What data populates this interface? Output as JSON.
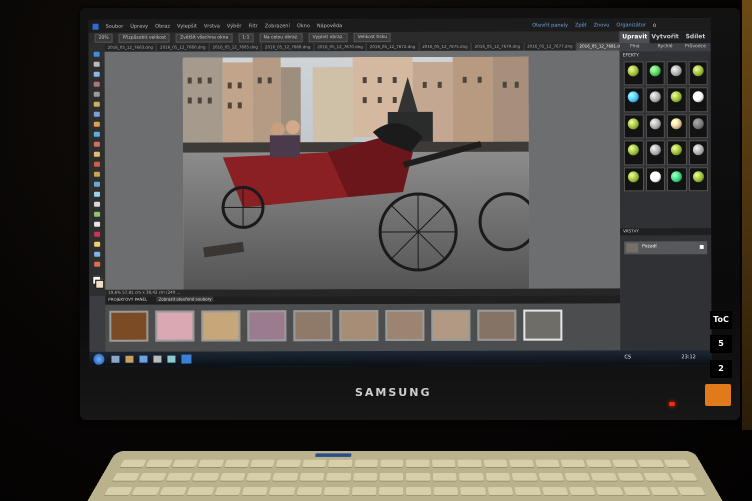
{
  "monitor": {
    "brand": "SAMSUNG"
  },
  "stickers": {
    "top": "ToC",
    "mid": "5",
    "bottom": "2"
  },
  "app": {
    "menu": [
      "Soubor",
      "Úpravy",
      "Obraz",
      "Vylepšit",
      "Vrstva",
      "Výběr",
      "Filtr",
      "Zobrazení",
      "Okno",
      "Nápověda"
    ],
    "top_right": {
      "open_panel": "Otevřít panely",
      "undo": "Zpět",
      "redo": "Znovu",
      "organizer": "Organizátor"
    },
    "options": {
      "zoom": "20%",
      "fit": "Přizpůsobit velikost",
      "fill": "Zvětšit všechna okna",
      "one_to_one": "1:1",
      "fit_screen": "Na celou obraz.",
      "fill_screen": "Vyplnit obraz.",
      "print_size": "Velikost tisku"
    },
    "tabs": [
      "2016_05_12_7663.dng",
      "2016_05_12_7660.dng",
      "2016_05_12_7665.dng",
      "2016_05_12_7668.dng",
      "2016_05_12_7670.dng",
      "2016_05_12_7672.dng",
      "2016_05_12_7675.dng",
      "2016_05_12_7679.dng",
      "2016_05_12_7677.dng",
      "2016_05_12_7681.dng @ 19,6% (RGB/8)"
    ],
    "status_text": "19,6%  57,81 cm x 38,42 cm (240 …",
    "bin_title": "PROJEKTOVÝ PANEL",
    "bin_dropdown": "Zobrazit otevřené soubory",
    "panel": {
      "tabs": [
        "Upravit",
        "Vytvořit",
        "Sdílet"
      ],
      "subtabs": [
        "Plná",
        "Rychlé",
        "Průvodce"
      ],
      "section_effects": "EFEKTY",
      "section_layers": "VRSTVY",
      "layer_name": "Pozadí"
    },
    "taskbar": {
      "lang": "CS",
      "clock": "23:12"
    }
  },
  "colors": {
    "panel_bg": "#2f3134",
    "canvas_bg": "#6c6e70",
    "carriage_red": "#8a1f24"
  }
}
